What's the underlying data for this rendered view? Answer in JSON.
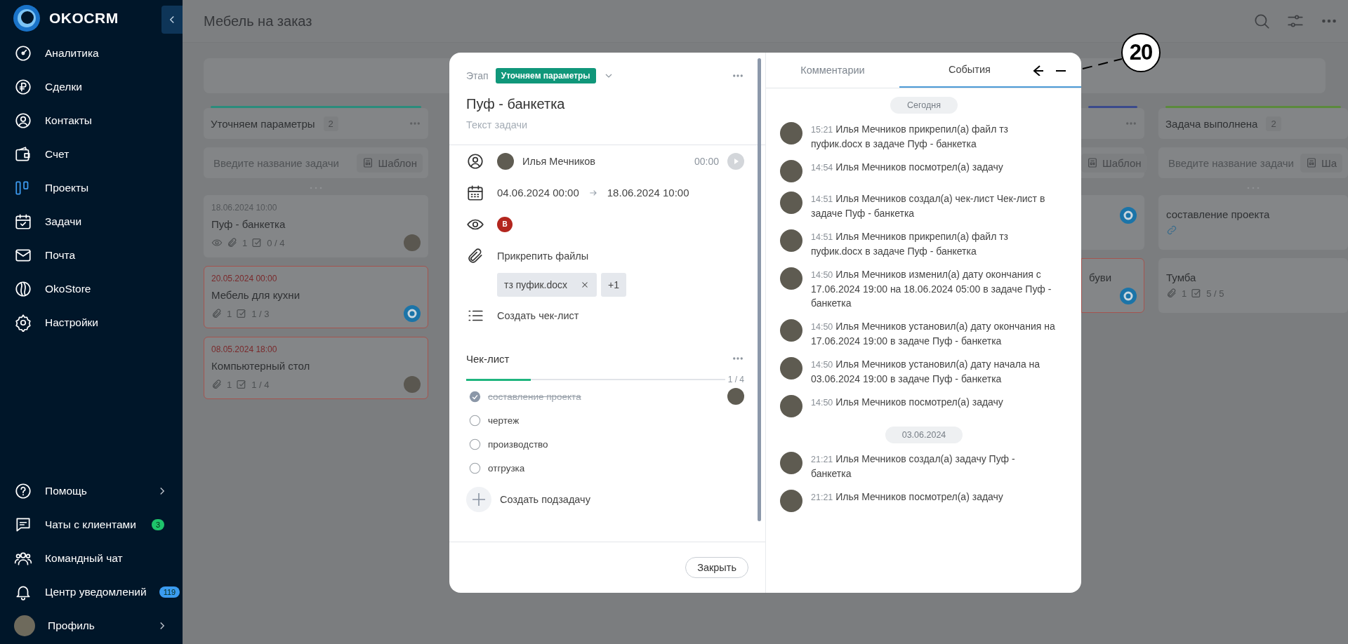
{
  "sidebar": {
    "logo": "OKOCRM",
    "items": [
      {
        "label": "Аналитика",
        "selected": false
      },
      {
        "label": "Сделки",
        "selected": false
      },
      {
        "label": "Контакты",
        "selected": false
      },
      {
        "label": "Счет",
        "selected": false
      },
      {
        "label": "Проекты",
        "selected": true
      },
      {
        "label": "Задачи",
        "selected": false
      },
      {
        "label": "Почта",
        "selected": false
      },
      {
        "label": "OkoStore",
        "selected": false
      },
      {
        "label": "Настройки",
        "selected": false
      }
    ],
    "bottom_items": [
      {
        "label": "Помощь",
        "has_submenu": true
      },
      {
        "label": "Чаты с клиентами",
        "badge": {
          "text": "3",
          "color": "#1ec46b"
        }
      },
      {
        "label": "Командный чат"
      },
      {
        "label": "Центр уведомлений",
        "badge": {
          "text": "119",
          "color": "#3b9cf0"
        }
      }
    ],
    "profile": {
      "label": "Профиль",
      "has_submenu": true
    }
  },
  "header": {
    "title": "Мебель на заказ"
  },
  "board": {
    "columns": [
      {
        "kind": "full",
        "title": "Уточняем параметры",
        "count": "2",
        "color": "#2b8c7c",
        "placeholder": "Введите название задачи",
        "template_label": "Шаблон",
        "cards": [
          {
            "date": "18.06.2024 10:00",
            "overdue": false,
            "title": "Пуф - банкетка",
            "watched": true,
            "attachments": "1",
            "checklist": "0 / 4",
            "assignee": {
              "kind": "avatar"
            }
          },
          {
            "date": "20.05.2024 00:00",
            "overdue": true,
            "title": "Мебель для кухни",
            "watched": false,
            "attachments": "1",
            "checklist": "1 / 3",
            "assignee": {
              "kind": "bot"
            }
          },
          {
            "date": "08.05.2024 18:00",
            "overdue": true,
            "title": "Компьютерный стол",
            "watched": false,
            "attachments": "1",
            "checklist": "1 / 4",
            "assignee": {
              "kind": "avatar"
            }
          }
        ]
      },
      {
        "kind": "partial",
        "color": "#3b4a8c",
        "template_label": "Шаблон",
        "cards": [
          {
            "overdue": false,
            "assignee": {
              "kind": "bot"
            }
          },
          {
            "overdue": true,
            "title": "буви",
            "assignee": {
              "kind": "bot"
            }
          }
        ]
      },
      {
        "kind": "full",
        "title": "Задача выполнена",
        "count": "2",
        "color": "#5b8a3c",
        "placeholder": "Введите название задачи",
        "template_label": "Ша",
        "cards": [
          {
            "overdue": false,
            "title": "составление проекта",
            "has_link": true
          },
          {
            "overdue": false,
            "title": "Тумба",
            "attachments": "1",
            "checklist": "5 / 5"
          }
        ]
      }
    ]
  },
  "task": {
    "stage_label": "Этап",
    "stage": "Уточняем параметры",
    "title": "Пуф - банкетка",
    "description_placeholder": "Текст задачи",
    "assignee": {
      "name": "Илья Мечников",
      "timer": "00:00"
    },
    "dates": {
      "start": "04.06.2024 00:00",
      "end": "18.06.2024 10:00"
    },
    "watchers": [
      {
        "initial": "В",
        "color": "#b3261e"
      }
    ],
    "attach_label": "Прикрепить файлы",
    "files": [
      {
        "name": "тз пуфик.docx"
      }
    ],
    "more_files": "+1",
    "create_checklist": "Создать чек-лист",
    "checklist": {
      "title": "Чек-лист",
      "count": "1 / 4",
      "level": 0.25,
      "items": [
        {
          "text": "составление проекта",
          "checked": true,
          "assigned": true
        },
        {
          "text": "чертеж",
          "checked": false,
          "assigned": false
        },
        {
          "text": "производство",
          "checked": false,
          "assigned": false
        },
        {
          "text": "отгрузка",
          "checked": false,
          "assigned": false
        }
      ]
    },
    "create_subtask": "Создать подзадачу",
    "close_button": "Закрыть"
  },
  "activity": {
    "tabs": [
      {
        "label": "Комментарии",
        "selected": false
      },
      {
        "label": "События",
        "selected": true
      }
    ],
    "groups": [
      {
        "date": "Сегодня",
        "events": [
          {
            "time": "15:21",
            "text": "Илья Мечников прикрепил(а) файл тз пуфик.docx в задаче Пуф - банкетка"
          },
          {
            "time": "14:54",
            "text": "Илья Мечников посмотрел(а) задачу"
          },
          {
            "time": "14:51",
            "text": "Илья Мечников создал(а) чек-лист Чек-лист в задаче Пуф - банкетка"
          },
          {
            "time": "14:51",
            "text": "Илья Мечников прикрепил(а) файл тз пуфик.docx в задаче Пуф - банкетка"
          },
          {
            "time": "14:50",
            "text": "Илья Мечников изменил(а) дату окончания с 17.06.2024 19:00 на 18.06.2024 05:00 в задаче Пуф - банкетка"
          },
          {
            "time": "14:50",
            "text": "Илья Мечников установил(а) дату окончания на 17.06.2024 19:00 в задаче Пуф - банкетка"
          },
          {
            "time": "14:50",
            "text": "Илья Мечников установил(а) дату начала на 03.06.2024 19:00 в задаче Пуф - банкетка"
          },
          {
            "time": "14:50",
            "text": "Илья Мечников посмотрел(а) задачу"
          }
        ]
      },
      {
        "date": "03.06.2024",
        "events": [
          {
            "time": "21:21",
            "text": "Илья Мечников создал(а) задачу Пуф - банкетка"
          },
          {
            "time": "21:21",
            "text": "Илья Мечников посмотрел(а) задачу"
          }
        ]
      }
    ]
  },
  "callout": {
    "label": "20"
  }
}
